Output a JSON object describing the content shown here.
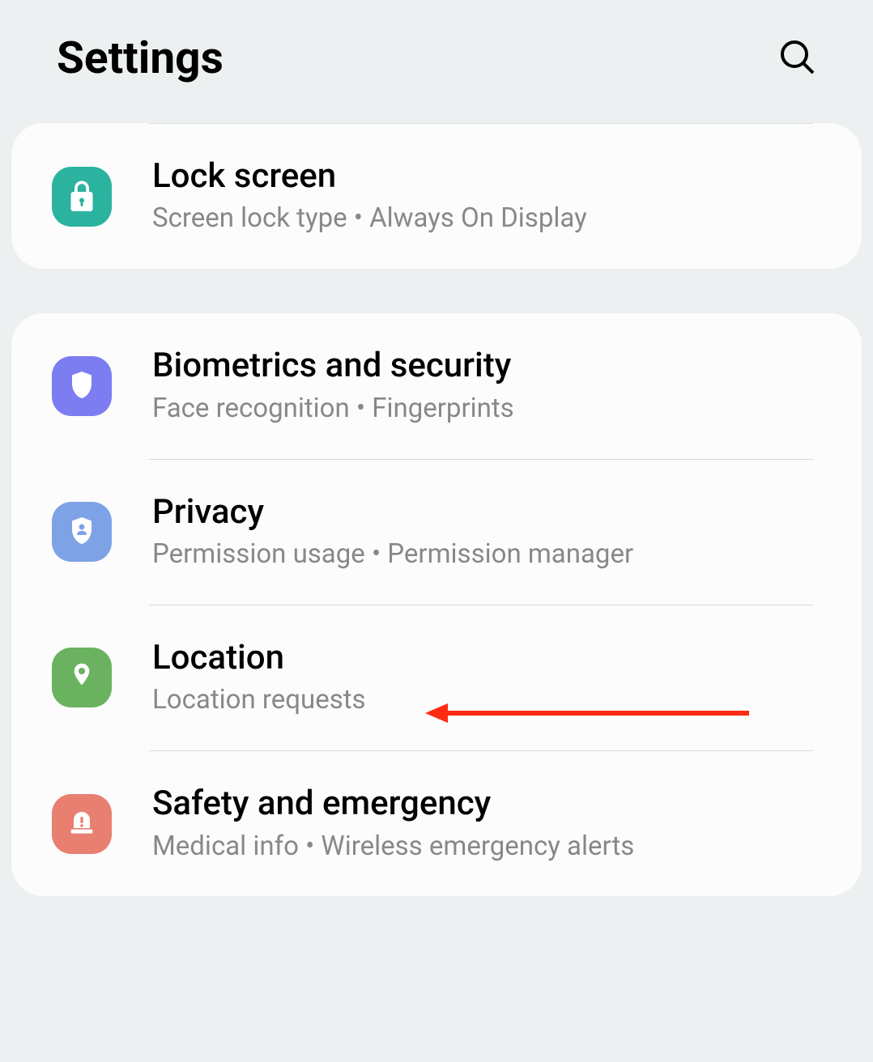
{
  "header": {
    "title": "Settings"
  },
  "groups": [
    {
      "items": [
        {
          "key": "lock-screen",
          "title": "Lock screen",
          "subtitle": "Screen lock type  •  Always On Display",
          "icon": "lock-icon",
          "icon_bg": "#2bb3a0"
        }
      ]
    },
    {
      "items": [
        {
          "key": "biometrics",
          "title": "Biometrics and security",
          "subtitle": "Face recognition  •  Fingerprints",
          "icon": "shield-icon",
          "icon_bg": "#7b7df0"
        },
        {
          "key": "privacy",
          "title": "Privacy",
          "subtitle": "Permission usage  •  Permission manager",
          "icon": "shield-person-icon",
          "icon_bg": "#7ea2e6"
        },
        {
          "key": "location",
          "title": "Location",
          "subtitle": "Location requests",
          "icon": "location-pin-icon",
          "icon_bg": "#6bb260"
        },
        {
          "key": "safety",
          "title": "Safety and emergency",
          "subtitle": "Medical info  •  Wireless emergency alerts",
          "icon": "emergency-icon",
          "icon_bg": "#e87f70"
        }
      ]
    }
  ],
  "annotation": {
    "type": "arrow",
    "target": "location",
    "color": "#ff2b12"
  }
}
